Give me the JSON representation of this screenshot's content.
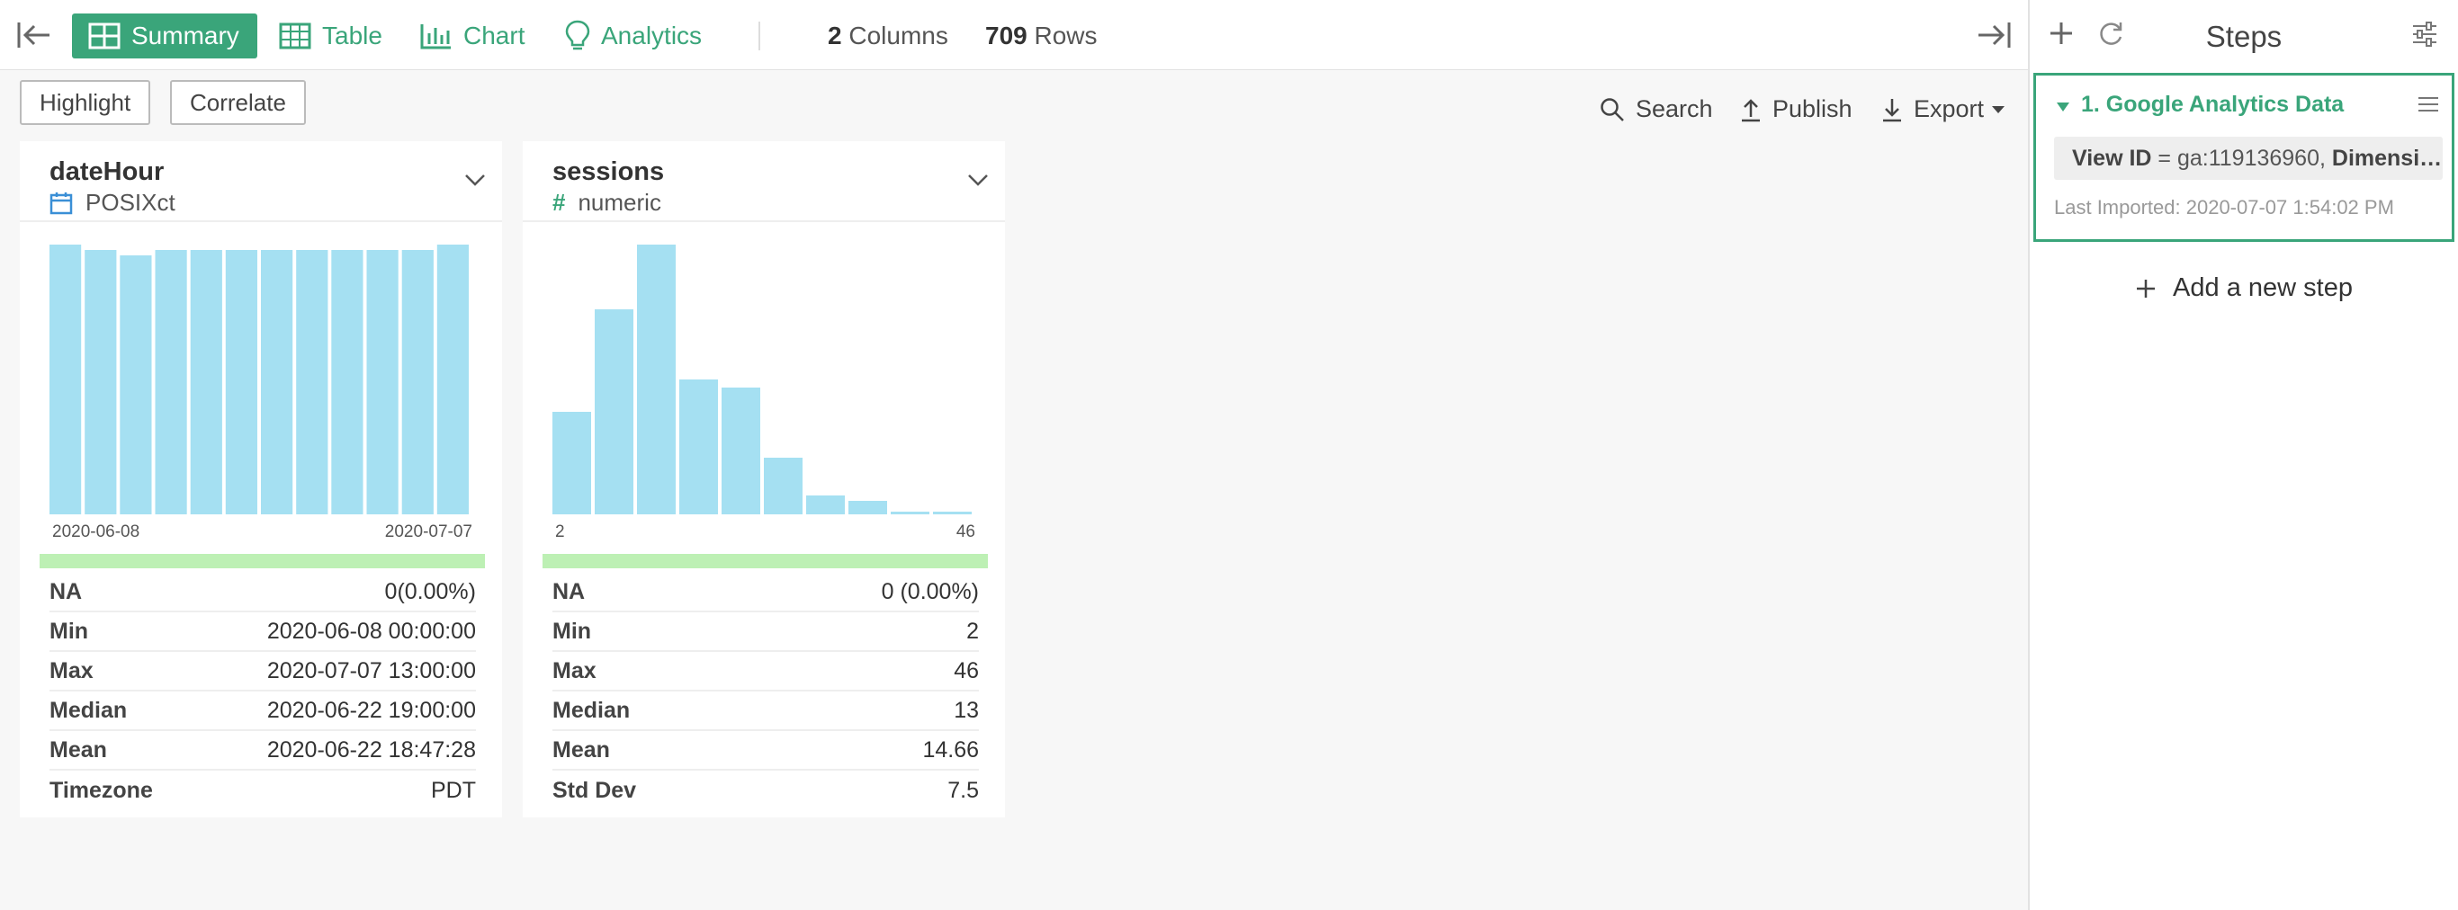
{
  "topbar": {
    "tabs": [
      {
        "label": "Summary",
        "icon": "grid-icon",
        "active": true
      },
      {
        "label": "Table",
        "icon": "table-icon",
        "active": false
      },
      {
        "label": "Chart",
        "icon": "bar-chart-icon",
        "active": false
      },
      {
        "label": "Analytics",
        "icon": "lightbulb-icon",
        "active": false
      }
    ],
    "columns_count": "2",
    "columns_label": "Columns",
    "rows_count": "709",
    "rows_label": "Rows"
  },
  "toolbar": {
    "highlight_label": "Highlight",
    "correlate_label": "Correlate",
    "search_label": "Search",
    "publish_label": "Publish",
    "export_label": "Export"
  },
  "cards": [
    {
      "name": "dateHour",
      "type": "POSIXct",
      "type_icon": "calendar-icon",
      "histogram": {
        "values": [
          100,
          98,
          96,
          98,
          98,
          98,
          98,
          98,
          98,
          98,
          98,
          100
        ]
      },
      "axis_min": "2020-06-08",
      "axis_max": "2020-07-07",
      "stats": [
        {
          "label": "NA",
          "value": "0(0.00%)"
        },
        {
          "label": "Min",
          "value": "2020-06-08 00:00:00"
        },
        {
          "label": "Max",
          "value": "2020-07-07 13:00:00"
        },
        {
          "label": "Median",
          "value": "2020-06-22 19:00:00"
        },
        {
          "label": "Mean",
          "value": "2020-06-22 18:47:28"
        },
        {
          "label": "Timezone",
          "value": "PDT"
        }
      ]
    },
    {
      "name": "sessions",
      "type": "numeric",
      "type_icon": "hash-icon",
      "histogram": {
        "values": [
          38,
          76,
          100,
          50,
          47,
          21,
          7,
          5,
          1,
          1
        ]
      },
      "axis_min": "2",
      "axis_max": "46",
      "stats": [
        {
          "label": "NA",
          "value": "0 (0.00%)"
        },
        {
          "label": "Min",
          "value": "2"
        },
        {
          "label": "Max",
          "value": "46"
        },
        {
          "label": "Median",
          "value": "13"
        },
        {
          "label": "Mean",
          "value": "14.66"
        },
        {
          "label": "Std Dev",
          "value": "7.5"
        }
      ]
    }
  ],
  "steps": {
    "title": "Steps",
    "step": {
      "title": "1. Google Analytics Data",
      "param1_key": "View ID",
      "param1_eq": " = ga:119136960, ",
      "param2_key": "Dimensi…",
      "last_imported": "Last Imported: 2020-07-07 1:54:02 PM"
    },
    "add_label": "Add a new step"
  },
  "colors": {
    "accent": "#3aa57a",
    "bar": "#a5e0f2",
    "quality_bar": "#bdf0b4"
  }
}
